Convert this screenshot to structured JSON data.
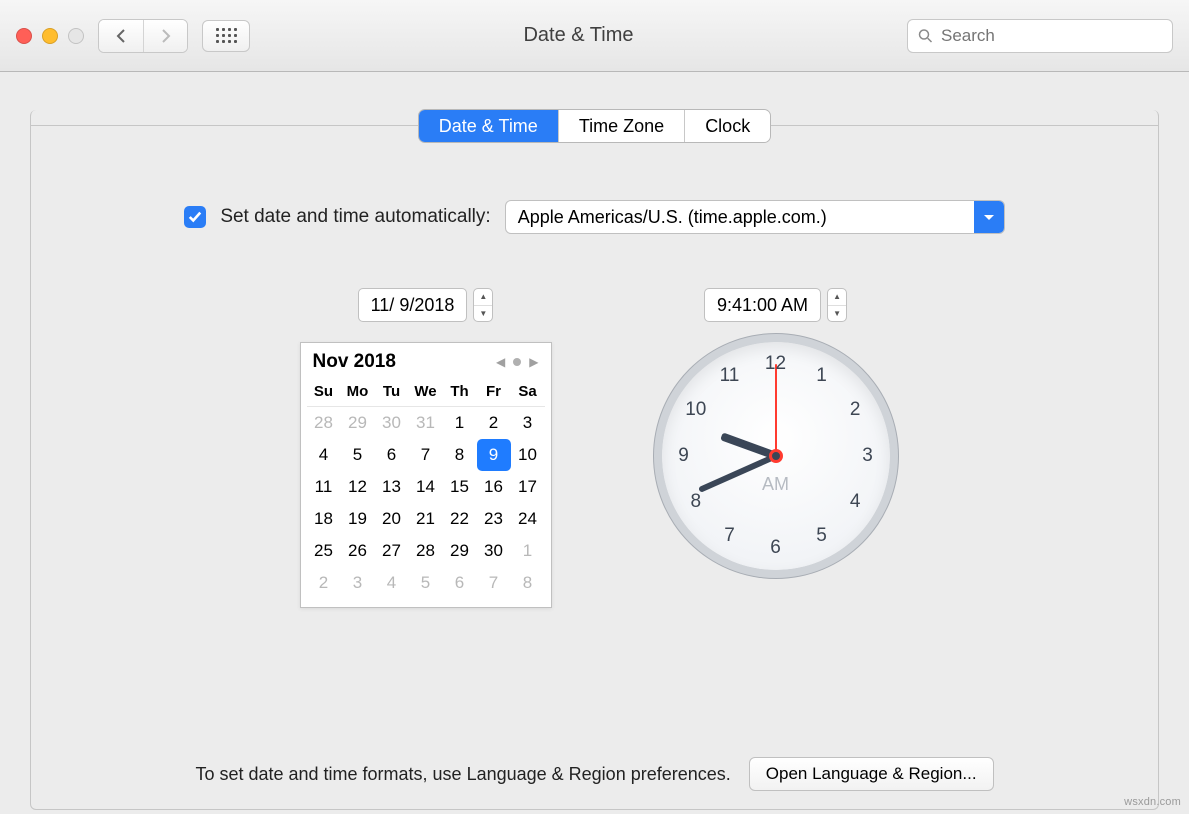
{
  "window": {
    "title": "Date & Time",
    "search_placeholder": "Search"
  },
  "tabs": {
    "date_time": "Date & Time",
    "time_zone": "Time Zone",
    "clock": "Clock",
    "active": "date_time"
  },
  "auto": {
    "checked": true,
    "label": "Set date and time automatically:",
    "server": "Apple Americas/U.S. (time.apple.com.)"
  },
  "date_field": "11/  9/2018",
  "time_field": "9:41:00 AM",
  "calendar": {
    "title": "Nov 2018",
    "dow": [
      "Su",
      "Mo",
      "Tu",
      "We",
      "Th",
      "Fr",
      "Sa"
    ],
    "days": [
      {
        "n": "28",
        "m": true
      },
      {
        "n": "29",
        "m": true
      },
      {
        "n": "30",
        "m": true
      },
      {
        "n": "31",
        "m": true
      },
      {
        "n": "1"
      },
      {
        "n": "2"
      },
      {
        "n": "3"
      },
      {
        "n": "4"
      },
      {
        "n": "5"
      },
      {
        "n": "6"
      },
      {
        "n": "7"
      },
      {
        "n": "8"
      },
      {
        "n": "9",
        "sel": true
      },
      {
        "n": "10"
      },
      {
        "n": "11"
      },
      {
        "n": "12"
      },
      {
        "n": "13"
      },
      {
        "n": "14"
      },
      {
        "n": "15"
      },
      {
        "n": "16"
      },
      {
        "n": "17"
      },
      {
        "n": "18"
      },
      {
        "n": "19"
      },
      {
        "n": "20"
      },
      {
        "n": "21"
      },
      {
        "n": "22"
      },
      {
        "n": "23"
      },
      {
        "n": "24"
      },
      {
        "n": "25"
      },
      {
        "n": "26"
      },
      {
        "n": "27"
      },
      {
        "n": "28"
      },
      {
        "n": "29"
      },
      {
        "n": "30"
      },
      {
        "n": "1",
        "m": true
      },
      {
        "n": "2",
        "m": true
      },
      {
        "n": "3",
        "m": true
      },
      {
        "n": "4",
        "m": true
      },
      {
        "n": "5",
        "m": true
      },
      {
        "n": "6",
        "m": true
      },
      {
        "n": "7",
        "m": true
      },
      {
        "n": "8",
        "m": true
      }
    ]
  },
  "clock": {
    "ampm": "AM",
    "numbers": [
      "12",
      "1",
      "2",
      "3",
      "4",
      "5",
      "6",
      "7",
      "8",
      "9",
      "10",
      "11"
    ]
  },
  "footer": {
    "hint": "To set date and time formats, use Language & Region preferences.",
    "button": "Open Language & Region..."
  },
  "watermark": "wsxdn.com"
}
